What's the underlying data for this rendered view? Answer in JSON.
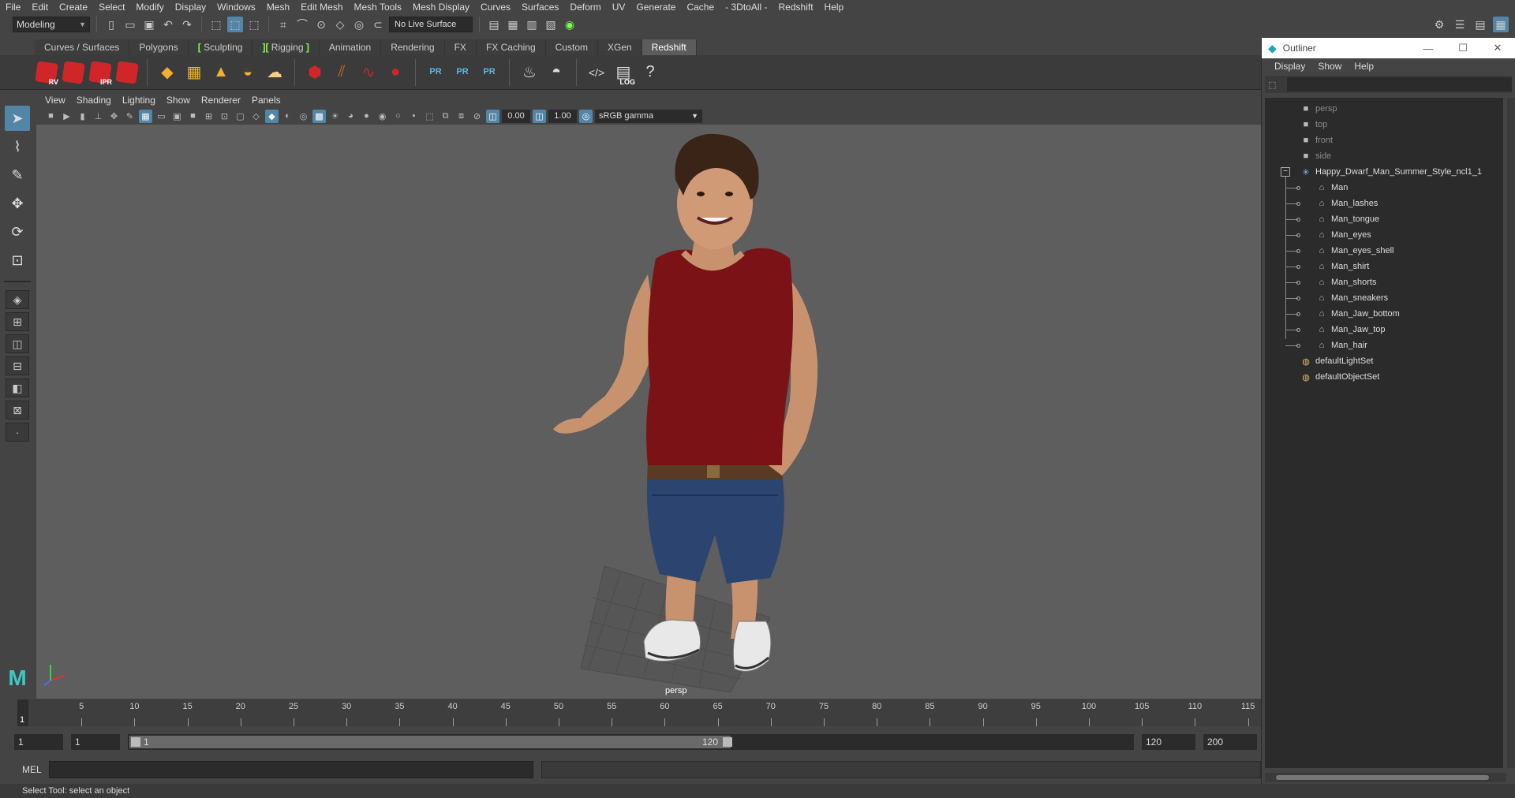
{
  "menubar": {
    "items": [
      "File",
      "Edit",
      "Create",
      "Select",
      "Modify",
      "Display",
      "Windows",
      "Mesh",
      "Edit Mesh",
      "Mesh Tools",
      "Mesh Display",
      "Curves",
      "Surfaces",
      "Deform",
      "UV",
      "Generate",
      "Cache",
      "- 3DtoAll -",
      "Redshift",
      "Help"
    ]
  },
  "statusline": {
    "mode": "Modeling",
    "live_surface": "No Live Surface"
  },
  "shelf": {
    "tabs": [
      "Curves / Surfaces",
      "Polygons",
      "Sculpting",
      "Rigging",
      "Animation",
      "Rendering",
      "FX",
      "FX Caching",
      "Custom",
      "XGen",
      "Redshift"
    ],
    "active_tab": "Redshift",
    "labels": {
      "rv": "RV",
      "ipr": "IPR",
      "pr": "PR",
      "log": "LOG"
    }
  },
  "viewport": {
    "menu": [
      "View",
      "Shading",
      "Lighting",
      "Show",
      "Renderer",
      "Panels"
    ],
    "exposure": "0.00",
    "gamma": "1.00",
    "color_space": "sRGB gamma",
    "camera_label": "persp"
  },
  "timeline": {
    "current_frame": "1",
    "ticks": [
      "5",
      "10",
      "15",
      "20",
      "25",
      "30",
      "35",
      "40",
      "45",
      "50",
      "55",
      "60",
      "65",
      "70",
      "75",
      "80",
      "85",
      "90",
      "95",
      "100",
      "105",
      "110",
      "115"
    ]
  },
  "range": {
    "start": "1",
    "playback_start": "1",
    "slider_start": "1",
    "slider_end": "120",
    "playback_end": "120",
    "end": "200"
  },
  "commandline": {
    "language": "MEL",
    "help": "Select Tool: select an object"
  },
  "outliner": {
    "title": "Outliner",
    "menu": [
      "Display",
      "Show",
      "Help"
    ],
    "cameras": [
      "persp",
      "top",
      "front",
      "side"
    ],
    "group": "Happy_Dwarf_Man_Summer_Style_ncl1_1",
    "meshes": [
      "Man",
      "Man_lashes",
      "Man_tongue",
      "Man_eyes",
      "Man_eyes_shell",
      "Man_shirt",
      "Man_shorts",
      "Man_sneakers",
      "Man_Jaw_bottom",
      "Man_Jaw_top",
      "Man_hair"
    ],
    "sets": [
      "defaultLightSet",
      "defaultObjectSet"
    ]
  },
  "colors": {
    "accent": "#5285a6",
    "redshift": "#d0262a",
    "maya_teal": "#3cc9c2",
    "shirt": "#7a1216",
    "shorts": "#2b4470"
  }
}
